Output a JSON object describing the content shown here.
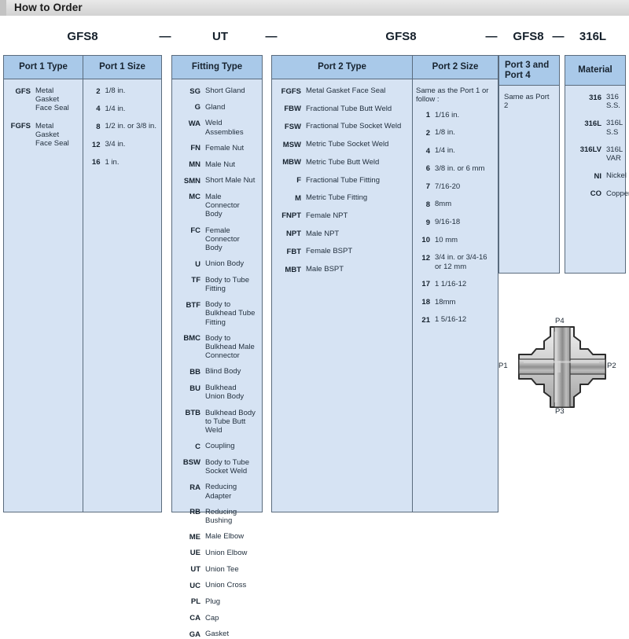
{
  "title": "How to Order",
  "part_number": {
    "segments": [
      "GFS8",
      "UT",
      "GFS8",
      "GFS8",
      "316L"
    ],
    "separator": "—"
  },
  "tables": {
    "port1": {
      "headers": [
        "Port 1 Type",
        "Port 1 Size"
      ],
      "type_rows": [
        {
          "code": "GFS",
          "desc": "Metal Gasket Face Seal"
        },
        {
          "code": "FGFS",
          "desc": "Metal Gasket Face Seal"
        }
      ],
      "size_rows": [
        {
          "code": "2",
          "desc": "1/8 in."
        },
        {
          "code": "4",
          "desc": "1/4 in."
        },
        {
          "code": "8",
          "desc": "1/2 in. or 3/8 in."
        },
        {
          "code": "12",
          "desc": "3/4 in."
        },
        {
          "code": "16",
          "desc": "1 in."
        }
      ]
    },
    "fitting": {
      "header": "Fitting Type",
      "rows": [
        {
          "code": "SG",
          "desc": "Short Gland"
        },
        {
          "code": "G",
          "desc": "Gland"
        },
        {
          "code": "WA",
          "desc": "Weld Assemblies"
        },
        {
          "code": "FN",
          "desc": "Female Nut"
        },
        {
          "code": "MN",
          "desc": "Male Nut"
        },
        {
          "code": "SMN",
          "desc": "Short Male Nut"
        },
        {
          "code": "MC",
          "desc": "Male Connector Body"
        },
        {
          "code": "FC",
          "desc": "Female Connector Body"
        },
        {
          "code": "U",
          "desc": "Union Body"
        },
        {
          "code": "TF",
          "desc": "Body to Tube Fitting"
        },
        {
          "code": "BTF",
          "desc": "Body to Bulkhead Tube Fitting"
        },
        {
          "code": "BMC",
          "desc": "Body to Bulkhead Male Connector"
        },
        {
          "code": "BB",
          "desc": "Blind Body"
        },
        {
          "code": "BU",
          "desc": "Bulkhead Union Body"
        },
        {
          "code": "BTB",
          "desc": "Bulkhead Body to Tube Butt Weld"
        },
        {
          "code": "C",
          "desc": "Coupling"
        },
        {
          "code": "BSW",
          "desc": "Body to Tube Socket Weld"
        },
        {
          "code": "RA",
          "desc": "Reducing Adapter"
        },
        {
          "code": "RB",
          "desc": "Reducing Bushing"
        },
        {
          "code": "ME",
          "desc": "Male Elbow"
        },
        {
          "code": "UE",
          "desc": "Union Elbow"
        },
        {
          "code": "UT",
          "desc": "Union Tee"
        },
        {
          "code": "UC",
          "desc": "Union Cross"
        },
        {
          "code": "PL",
          "desc": "Plug"
        },
        {
          "code": "CA",
          "desc": "Cap"
        },
        {
          "code": "GA",
          "desc": "Gasket"
        }
      ]
    },
    "port2": {
      "headers": [
        "Port 2 Type",
        "Port 2 Size"
      ],
      "type_rows": [
        {
          "code": "FGFS",
          "desc": "Metal Gasket Face Seal"
        },
        {
          "code": "FBW",
          "desc": "Fractional Tube Butt Weld"
        },
        {
          "code": "FSW",
          "desc": "Fractional Tube Socket Weld"
        },
        {
          "code": "MSW",
          "desc": "Metric Tube Socket Weld"
        },
        {
          "code": "MBW",
          "desc": "Metric Tube Butt Weld"
        },
        {
          "code": "F",
          "desc": "Fractional Tube Fitting"
        },
        {
          "code": "M",
          "desc": "Metric Tube Fitting"
        },
        {
          "code": "FNPT",
          "desc": "Female NPT"
        },
        {
          "code": "NPT",
          "desc": "Male NPT"
        },
        {
          "code": "FBT",
          "desc": "Female BSPT"
        },
        {
          "code": "MBT",
          "desc": "Male BSPT"
        }
      ],
      "size_note": "Same as the Port 1 or  follow :",
      "size_rows": [
        {
          "code": "1",
          "desc": "1/16 in."
        },
        {
          "code": "2",
          "desc": "1/8 in."
        },
        {
          "code": "4",
          "desc": "1/4 in."
        },
        {
          "code": "6",
          "desc": "3/8 in. or 6 mm"
        },
        {
          "code": "7",
          "desc": "7/16-20"
        },
        {
          "code": "8",
          "desc": "8mm"
        },
        {
          "code": "9",
          "desc": "9/16-18"
        },
        {
          "code": "10",
          "desc": "10 mm"
        },
        {
          "code": "12",
          "desc": "3/4 in. or 3/4-16 or 12 mm"
        },
        {
          "code": "17",
          "desc": "1 1/16-12"
        },
        {
          "code": "18",
          "desc": "18mm"
        },
        {
          "code": "21",
          "desc": "1 5/16-12"
        }
      ]
    },
    "port34": {
      "header": "Port 3 and Port 4",
      "note": "Same as  Port 2"
    },
    "material": {
      "header": "Material",
      "rows": [
        {
          "code": "316",
          "desc": "316 S.S."
        },
        {
          "code": "316L",
          "desc": "316L S.S"
        },
        {
          "code": "316LV",
          "desc": "316L VAR"
        },
        {
          "code": "NI",
          "desc": "Nickel"
        },
        {
          "code": "CO",
          "desc": "Copper"
        }
      ]
    }
  },
  "diagram": {
    "labels": {
      "p1": "P1",
      "p2": "P2",
      "p3": "P3",
      "p4": "P4"
    }
  },
  "colors": {
    "header_blue": "#a9c9e9",
    "cell_blue": "#d6e3f3",
    "border": "#5a6b7d",
    "titlebar_gray": "#dcdcdc"
  }
}
